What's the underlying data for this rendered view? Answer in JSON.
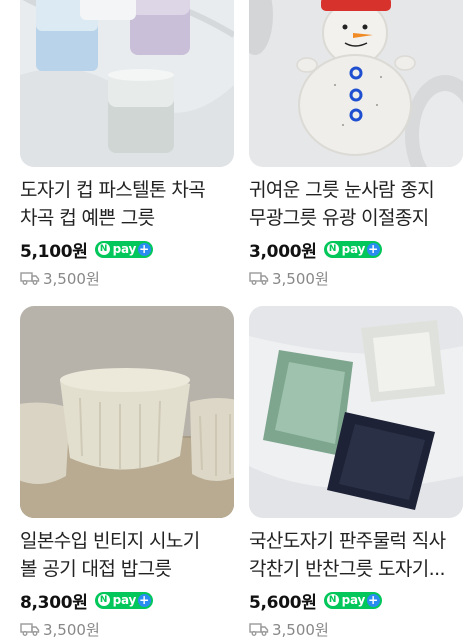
{
  "products": [
    {
      "title_line1": "도자기 컵 파스텔톤 차곡",
      "title_line2": "차곡 컵 예쁜 그릇",
      "price": "5,100원",
      "npay_label": "pay",
      "shipping": "3,500원"
    },
    {
      "title_line1": "귀여운 그릇 눈사람 종지",
      "title_line2": "무광그릇 유광 이절종지",
      "price": "3,000원",
      "npay_label": "pay",
      "shipping": "3,500원"
    },
    {
      "title_line1": "일본수입 빈티지 시노기",
      "title_line2": "볼 공기 대접 밥그릇",
      "price": "8,300원",
      "npay_label": "pay",
      "shipping": "3,500원"
    },
    {
      "title_line1": "국산도자기 판주물럭 직사",
      "title_line2": "각찬기 반찬그릇 도자기...",
      "price": "5,600원",
      "npay_label": "pay",
      "shipping": "3,500원"
    }
  ],
  "icons": {
    "npay": "naver-pay-icon",
    "plus": "plus-icon",
    "shipping": "truck-icon"
  },
  "colors": {
    "npay_green": "#03c75a",
    "npay_plus_blue": "#2a8cf0",
    "shipping_gray": "#888888"
  }
}
